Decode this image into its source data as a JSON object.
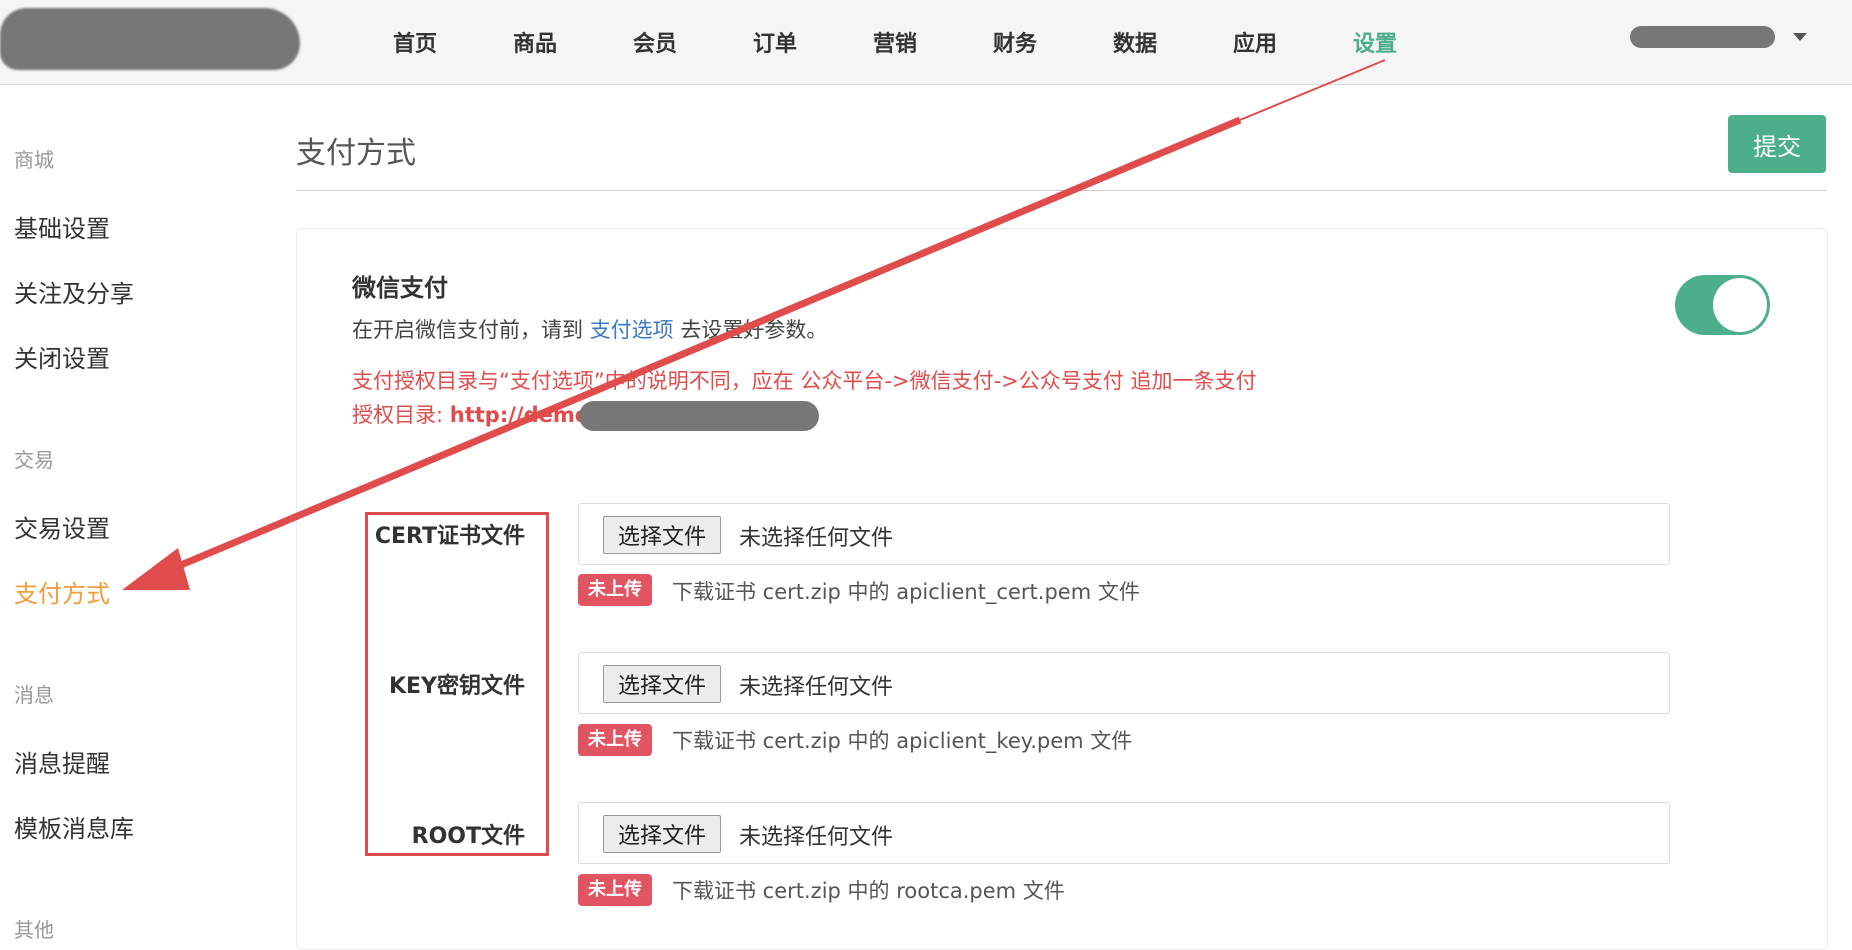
{
  "nav": {
    "items": [
      {
        "label": "首页"
      },
      {
        "label": "商品"
      },
      {
        "label": "会员"
      },
      {
        "label": "订单"
      },
      {
        "label": "营销"
      },
      {
        "label": "财务"
      },
      {
        "label": "数据"
      },
      {
        "label": "应用"
      },
      {
        "label": "设置",
        "active": true
      }
    ]
  },
  "sidebar": {
    "groups": [
      {
        "title": "商城",
        "items": [
          "基础设置",
          "关注及分享",
          "关闭设置"
        ]
      },
      {
        "title": "交易",
        "items": [
          "交易设置",
          "支付方式"
        ]
      },
      {
        "title": "消息",
        "items": [
          "消息提醒",
          "模板消息库"
        ]
      },
      {
        "title": "其他",
        "items": []
      }
    ],
    "active_item": "支付方式"
  },
  "page": {
    "title": "支付方式",
    "submit_label": "提交"
  },
  "wechat_pay": {
    "title": "微信支付",
    "desc_prefix": "在开启微信支付前，请到",
    "desc_link": "支付选项",
    "desc_suffix": "去设置好参数。",
    "warning_line1": "支付授权目录与“支付选项”中的说明不同，应在 公众平台->微信支付->公众号支付 追加一条支付",
    "warning_line2_prefix": "授权目录: ",
    "warning_url": "http://demo",
    "enabled": true
  },
  "files": [
    {
      "label": "CERT证书文件",
      "button": "选择文件",
      "status": "未选择任何文件",
      "badge": "未上传",
      "hint": "下载证书 cert.zip 中的 apiclient_cert.pem 文件"
    },
    {
      "label": "KEY密钥文件",
      "button": "选择文件",
      "status": "未选择任何文件",
      "badge": "未上传",
      "hint": "下载证书 cert.zip 中的 apiclient_key.pem 文件"
    },
    {
      "label": "ROOT文件",
      "button": "选择文件",
      "status": "未选择任何文件",
      "badge": "未上传",
      "hint": "下载证书 cert.zip 中的 rootca.pem 文件"
    }
  ],
  "colors": {
    "accent": "#4caf8a",
    "active_side": "#f39c3b",
    "warning": "#e04b4b",
    "badge": "#e05561",
    "link": "#3a78c3"
  }
}
